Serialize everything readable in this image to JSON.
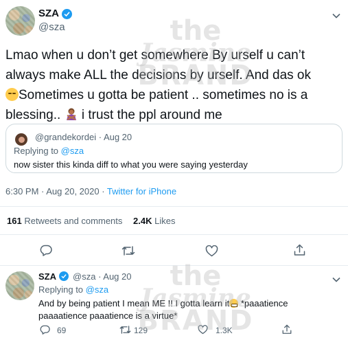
{
  "main_tweet": {
    "name": "SZA",
    "handle": "@sza",
    "text_lines": [
      "Lmao when u don’t get somewhere By urself u can’t",
      "always make ALL the decisions by urself. And das ok",
      "Sometimes u gotta be patient .. sometimes no is a",
      "blessing..",
      "i trust the ppl around me"
    ],
    "emojis": [
      "relieved-face",
      "person-gesturing-no"
    ],
    "quoted": {
      "handle": "@grandekordei",
      "date": "· Aug 20",
      "replying_prefix": "Replying to ",
      "replying_to": "@sza",
      "text": "now sister this kinda diff to what you were saying yesterday"
    },
    "timestamp": "6:30 PM · Aug 20, 2020 · ",
    "source": "Twitter for iPhone",
    "stats": {
      "retweets_count": "161",
      "retweets_label": "Retweets and comments",
      "likes_count": "2.4K",
      "likes_label": "Likes"
    }
  },
  "reply_tweet": {
    "name": "SZA",
    "handle": "@sza",
    "date": "· Aug 20",
    "replying_prefix": "Replying to ",
    "replying_to": "@sza",
    "text_line1": "And by being patient I mean ME !! I gotta learn it",
    "text_line1_tail": " *paaatience",
    "text_line2": "paaaatience paaatience is a virtue*",
    "reply_count": "69",
    "retweet_count": "129",
    "like_count": "1.3K"
  },
  "watermarks": {
    "top": [
      "the",
      "Jasmine",
      "BRAND"
    ],
    "bottom": [
      "the",
      "Jasmine",
      "BRAND"
    ]
  },
  "colors": {
    "accent": "#1d9bf0",
    "text": "#0f1419",
    "muted": "#536471",
    "border": "#cfd9de"
  }
}
